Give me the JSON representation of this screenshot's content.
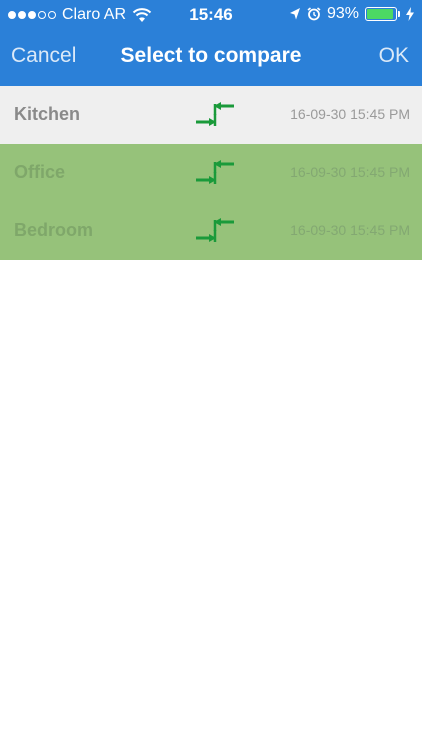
{
  "status_bar": {
    "carrier": "Claro AR",
    "time": "15:46",
    "battery_percent": "93%",
    "battery_level": 0.93,
    "signal_dots_filled": 3,
    "signal_dots_total": 5
  },
  "navbar": {
    "cancel_label": "Cancel",
    "title": "Select to compare",
    "ok_label": "OK"
  },
  "colors": {
    "header": "#2b80d8",
    "selected_row": "#96c27a",
    "unselected_row": "#efefef",
    "compare_icon": "#1a9a3a"
  },
  "rooms": [
    {
      "name": "Kitchen",
      "timestamp": "16-09-30 15:45 PM",
      "selected": false
    },
    {
      "name": "Office",
      "timestamp": "16-09-30 15:45 PM",
      "selected": true
    },
    {
      "name": "Bedroom",
      "timestamp": "16-09-30 15:45 PM",
      "selected": true
    }
  ]
}
